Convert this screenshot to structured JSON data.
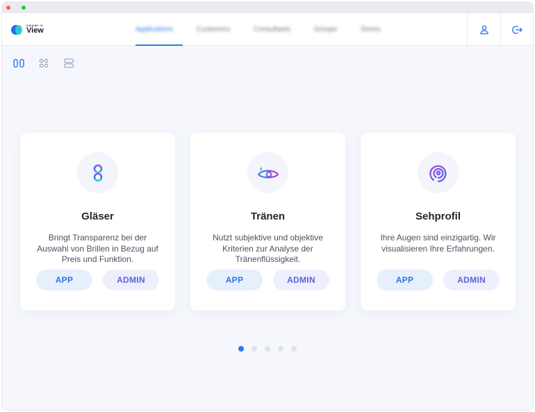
{
  "app": {
    "logo_small": "UNAMI O",
    "logo_name": "View"
  },
  "nav": {
    "tabs": [
      {
        "label": "Applications",
        "active": true
      },
      {
        "label": "Customers",
        "active": false
      },
      {
        "label": "Consultants",
        "active": false
      },
      {
        "label": "Groups",
        "active": false
      },
      {
        "label": "Stores",
        "active": false
      }
    ]
  },
  "header_actions": {
    "profile_icon": "user-icon",
    "logout_icon": "logout-icon"
  },
  "view_toggle": {
    "icons": [
      "columns-icon",
      "grid-icon",
      "list-icon"
    ],
    "active_index": 0
  },
  "cards": [
    {
      "icon": "glasses-g-icon",
      "title": "Gläser",
      "description": "Bringt Transparenz bei der Auswahl von Brillen in Bezug auf Preis und Funktion.",
      "app_label": "APP",
      "admin_label": "ADMIN"
    },
    {
      "icon": "eye-tear-icon",
      "title": "Tränen",
      "description": "Nutzt subjektive und objektive Kriterien zur Analyse der Tränenflüssigkeit.",
      "app_label": "APP",
      "admin_label": "ADMIN"
    },
    {
      "icon": "spiral-eye-icon",
      "title": "Sehprofil",
      "description": "Ihre Augen sind einzigartig. Wir visualisieren Ihre Erfahrungen.",
      "app_label": "APP",
      "admin_label": "ADMIN"
    }
  ],
  "pagination": {
    "page_count": 5,
    "current_page": 1
  },
  "colors": {
    "accent": "#2d7be8",
    "admin": "#5d63d8",
    "background": "#f5f7fc"
  }
}
